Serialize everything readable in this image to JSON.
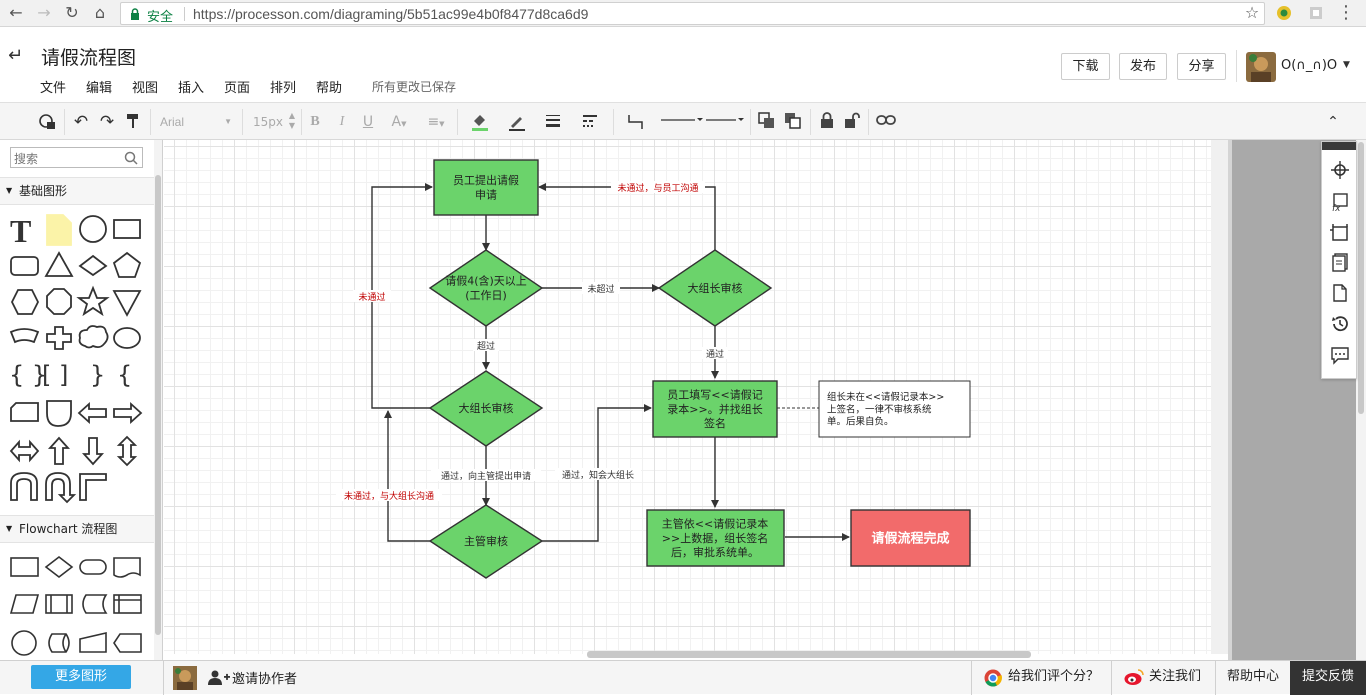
{
  "browser": {
    "secure_label": "安全",
    "url": "https://processon.com/diagraming/5b51ac99e4b0f8477d8ca6d9"
  },
  "header": {
    "title": "请假流程图",
    "menu": [
      "文件",
      "编辑",
      "视图",
      "插入",
      "页面",
      "排列",
      "帮助"
    ],
    "save_status": "所有更改已保存",
    "buttons": {
      "download": "下载",
      "publish": "发布",
      "share": "分享"
    },
    "user": "O(∩_∩)O"
  },
  "toolbar": {
    "font_family": "Arial",
    "font_size": "15px",
    "icons": [
      "format-brush-icon",
      "undo-icon",
      "redo-icon",
      "paint-format-icon",
      "bold-icon",
      "italic-icon",
      "underline-icon",
      "font-color-icon",
      "align-icon",
      "fill-color-icon",
      "line-color-icon",
      "line-width-icon",
      "line-style-icon",
      "connector-type-icon",
      "start-arrow-icon",
      "end-arrow-icon",
      "bring-front-icon",
      "send-back-icon",
      "lock-icon",
      "unlock-icon",
      "link-icon",
      "collapse-icon"
    ]
  },
  "sidebar": {
    "search_placeholder": "搜索",
    "sections": [
      {
        "label": "基础图形"
      },
      {
        "label": "Flowchart 流程图"
      }
    ],
    "more_shapes": "更多图形"
  },
  "diagram": {
    "nodes": {
      "n1": "员工提出请假\n申请",
      "d1": "请假4(含)天以上\n(工作日)",
      "d2": "大组长审核",
      "d3": "大组长审核",
      "d4": "主管审核",
      "n2": "员工填写<<请假记\n录本>>。并找组长\n签名",
      "note": "组长未在<<请假记录本>>\n上签名，一律不审核系统\n单。后果自负。",
      "n3": "主管依<<请假记录本\n>>上数据，组长签名\n后，审批系统单。",
      "done": "请假流程完成"
    },
    "edges": {
      "not_exceed": "未超过",
      "exceed": "超过",
      "pass": "通过",
      "reject_left": "未通过",
      "reject_right": "未通过，与员工沟通",
      "pass_to_manager": "通过，向主管提出申请",
      "pass_notify": "通过，知会大组长",
      "reject_manager": "未通过，与大组长沟通"
    },
    "colors": {
      "green": "#6bd36b",
      "red": "#f26b6b",
      "stroke": "#333333"
    }
  },
  "bottom": {
    "invite": "邀请协作者",
    "rate": "给我们评个分？",
    "follow": "关注我们",
    "help": "帮助中心",
    "feedback": "提交反馈"
  }
}
